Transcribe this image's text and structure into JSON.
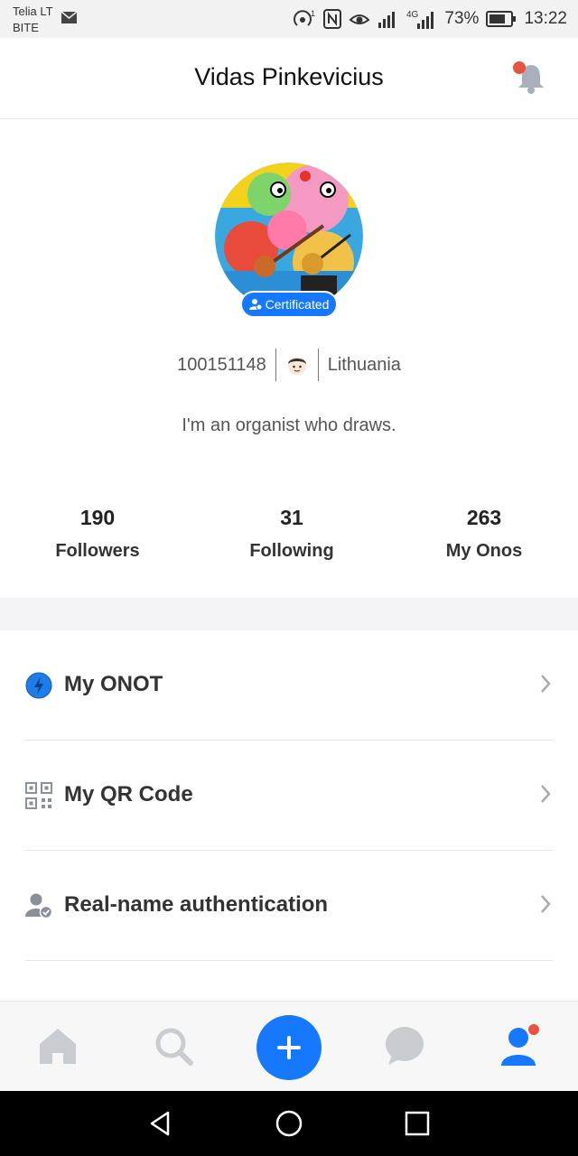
{
  "status_bar": {
    "carrier_1": "Telia LT",
    "carrier_2": "BITE",
    "network": "4G",
    "battery": "73%",
    "time": "13:22"
  },
  "header": {
    "title": "Vidas Pinkevicius"
  },
  "profile": {
    "badge": "Certificated",
    "user_id": "100151148",
    "country": "Lithuania",
    "bio": "I'm an organist who draws."
  },
  "stats": [
    {
      "value": "190",
      "label": "Followers"
    },
    {
      "value": "31",
      "label": "Following"
    },
    {
      "value": "263",
      "label": "My Onos"
    }
  ],
  "menu": [
    {
      "label": "My ONOT",
      "icon": "onot-icon"
    },
    {
      "label": "My QR Code",
      "icon": "qr-code-icon"
    },
    {
      "label": "Real-name authentication",
      "icon": "verified-user-icon"
    }
  ],
  "tabbar": {
    "items": [
      "home-icon",
      "search-icon",
      "add-icon",
      "chat-icon",
      "profile-icon"
    ],
    "active": "profile-icon"
  },
  "colors": {
    "accent": "#1677ff",
    "notification_dot": "#f04e3e",
    "inactive_icon": "#c9ccd1"
  }
}
